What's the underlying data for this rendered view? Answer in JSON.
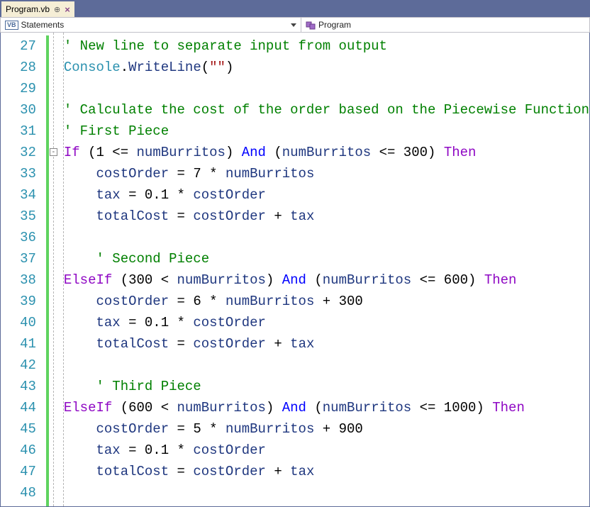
{
  "tab": {
    "title": "Program.vb"
  },
  "nav": {
    "left": "Statements",
    "right": "Program"
  },
  "lines": [
    {
      "n": 27,
      "ind": 12,
      "tokens": [
        [
          "comment",
          "' New line to separate input from output"
        ]
      ]
    },
    {
      "n": 28,
      "ind": 12,
      "tokens": [
        [
          "type",
          "Console"
        ],
        [
          "plain",
          "."
        ],
        [
          "member",
          "WriteLine"
        ],
        [
          "plain",
          "("
        ],
        [
          "string",
          "\"\""
        ],
        [
          "plain",
          ")"
        ]
      ]
    },
    {
      "n": 29,
      "ind": 12,
      "tokens": []
    },
    {
      "n": 30,
      "ind": 12,
      "tokens": [
        [
          "comment",
          "' Calculate the cost of the order based on the Piecewise Function"
        ]
      ]
    },
    {
      "n": 31,
      "ind": 12,
      "tokens": [
        [
          "comment",
          "' First Piece"
        ]
      ]
    },
    {
      "n": 32,
      "ind": 12,
      "tokens": [
        [
          "flow",
          "If"
        ],
        [
          "plain",
          " (1 <= "
        ],
        [
          "member",
          "numBurritos"
        ],
        [
          "plain",
          ") "
        ],
        [
          "keyword",
          "And"
        ],
        [
          "plain",
          " ("
        ],
        [
          "member",
          "numBurritos"
        ],
        [
          "plain",
          " <= 300) "
        ],
        [
          "flow",
          "Then"
        ]
      ]
    },
    {
      "n": 33,
      "ind": 16,
      "tokens": [
        [
          "member",
          "costOrder"
        ],
        [
          "plain",
          " = 7 * "
        ],
        [
          "member",
          "numBurritos"
        ]
      ]
    },
    {
      "n": 34,
      "ind": 16,
      "tokens": [
        [
          "member",
          "tax"
        ],
        [
          "plain",
          " = 0.1 * "
        ],
        [
          "member",
          "costOrder"
        ]
      ]
    },
    {
      "n": 35,
      "ind": 16,
      "tokens": [
        [
          "member",
          "totalCost"
        ],
        [
          "plain",
          " = "
        ],
        [
          "member",
          "costOrder"
        ],
        [
          "plain",
          " + "
        ],
        [
          "member",
          "tax"
        ]
      ]
    },
    {
      "n": 36,
      "ind": 16,
      "tokens": []
    },
    {
      "n": 37,
      "ind": 16,
      "tokens": [
        [
          "comment",
          "' Second Piece"
        ]
      ]
    },
    {
      "n": 38,
      "ind": 12,
      "tokens": [
        [
          "flow",
          "ElseIf"
        ],
        [
          "plain",
          " (300 < "
        ],
        [
          "member",
          "numBurritos"
        ],
        [
          "plain",
          ") "
        ],
        [
          "keyword",
          "And"
        ],
        [
          "plain",
          " ("
        ],
        [
          "member",
          "numBurritos"
        ],
        [
          "plain",
          " <= 600) "
        ],
        [
          "flow",
          "Then"
        ]
      ]
    },
    {
      "n": 39,
      "ind": 16,
      "tokens": [
        [
          "member",
          "costOrder"
        ],
        [
          "plain",
          " = 6 * "
        ],
        [
          "member",
          "numBurritos"
        ],
        [
          "plain",
          " + 300"
        ]
      ]
    },
    {
      "n": 40,
      "ind": 16,
      "tokens": [
        [
          "member",
          "tax"
        ],
        [
          "plain",
          " = 0.1 * "
        ],
        [
          "member",
          "costOrder"
        ]
      ]
    },
    {
      "n": 41,
      "ind": 16,
      "tokens": [
        [
          "member",
          "totalCost"
        ],
        [
          "plain",
          " = "
        ],
        [
          "member",
          "costOrder"
        ],
        [
          "plain",
          " + "
        ],
        [
          "member",
          "tax"
        ]
      ]
    },
    {
      "n": 42,
      "ind": 16,
      "tokens": []
    },
    {
      "n": 43,
      "ind": 16,
      "tokens": [
        [
          "comment",
          "' Third Piece"
        ]
      ]
    },
    {
      "n": 44,
      "ind": 12,
      "tokens": [
        [
          "flow",
          "ElseIf"
        ],
        [
          "plain",
          " (600 < "
        ],
        [
          "member",
          "numBurritos"
        ],
        [
          "plain",
          ") "
        ],
        [
          "keyword",
          "And"
        ],
        [
          "plain",
          " ("
        ],
        [
          "member",
          "numBurritos"
        ],
        [
          "plain",
          " <= 1000) "
        ],
        [
          "flow",
          "Then"
        ]
      ]
    },
    {
      "n": 45,
      "ind": 16,
      "tokens": [
        [
          "member",
          "costOrder"
        ],
        [
          "plain",
          " = 5 * "
        ],
        [
          "member",
          "numBurritos"
        ],
        [
          "plain",
          " + 900"
        ]
      ]
    },
    {
      "n": 46,
      "ind": 16,
      "tokens": [
        [
          "member",
          "tax"
        ],
        [
          "plain",
          " = 0.1 * "
        ],
        [
          "member",
          "costOrder"
        ]
      ]
    },
    {
      "n": 47,
      "ind": 16,
      "tokens": [
        [
          "member",
          "totalCost"
        ],
        [
          "plain",
          " = "
        ],
        [
          "member",
          "costOrder"
        ],
        [
          "plain",
          " + "
        ],
        [
          "member",
          "tax"
        ]
      ]
    },
    {
      "n": 48,
      "ind": 16,
      "tokens": []
    }
  ],
  "foldAtLine": 32
}
